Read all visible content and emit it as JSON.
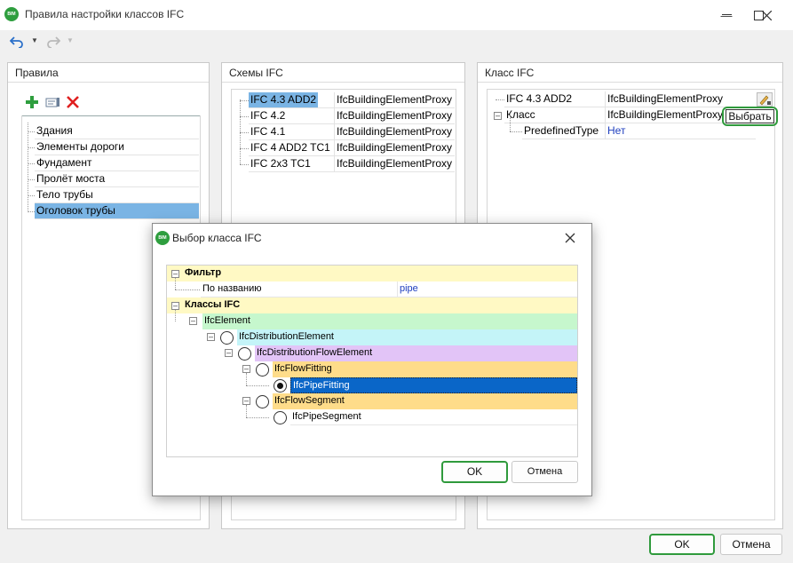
{
  "window": {
    "title": "Правила настройки классов IFC",
    "app_icon_text": "BIM",
    "controls": [
      "minimize-icon",
      "maximize-icon",
      "close-icon"
    ]
  },
  "toolbar": {
    "undo_icon": "undo-icon",
    "redo_icon": "redo-icon"
  },
  "rules_panel": {
    "header": "Правила",
    "actions": [
      "add-icon",
      "edit-icon",
      "delete-icon"
    ],
    "items": [
      "Здания",
      "Элементы дороги",
      "Фундамент",
      "Пролёт моста",
      "Тело трубы",
      "Оголовок трубы"
    ],
    "selected": "Оголовок трубы"
  },
  "schemas_panel": {
    "header": "Схемы IFC",
    "rows": [
      {
        "schema": "IFC 4.3 ADD2",
        "class": "IfcBuildingElementProxy"
      },
      {
        "schema": "IFC 4.2",
        "class": "IfcBuildingElementProxy"
      },
      {
        "schema": "IFC 4.1",
        "class": "IfcBuildingElementProxy"
      },
      {
        "schema": "IFC 4 ADD2 TC1",
        "class": "IfcBuildingElementProxy"
      },
      {
        "schema": "IFC 2x3 TC1",
        "class": "IfcBuildingElementProxy"
      }
    ]
  },
  "class_panel": {
    "header": "Класс IFC",
    "schema_label": "IFC 4.3 ADD2",
    "schema_value": "IfcBuildingElementProxy",
    "class_label": "Класс",
    "class_value": "IfcBuildingElementProxy",
    "choose_button": "Выбрать",
    "predefined_label": "PredefinedType",
    "predefined_value": "Нет"
  },
  "dialog": {
    "title": "Выбор класса IFC",
    "filter_header": "Фильтр",
    "filter_by_name_label": "По названию",
    "filter_by_name_value": "pipe",
    "classes_header": "Классы IFC",
    "tree": [
      {
        "label": "IfcElement",
        "color": "#c6f7cd"
      },
      {
        "label": "IfcDistributionElement",
        "color": "#c4f4f8"
      },
      {
        "label": "IfcDistributionFlowElement",
        "color": "#e2c4f7"
      },
      {
        "label": "IfcFlowFitting",
        "color": "#fedc8a"
      },
      {
        "label": "IfcPipeFitting",
        "color": "#0a66c8",
        "selected": true
      },
      {
        "label": "IfcFlowSegment",
        "color": "#fedc8a"
      },
      {
        "label": "IfcPipeSegment",
        "color": "#ffffff"
      }
    ],
    "ok_button": "OK",
    "cancel_button": "Отмена"
  },
  "footer": {
    "ok_button": "OK",
    "cancel_button": "Отмена"
  }
}
